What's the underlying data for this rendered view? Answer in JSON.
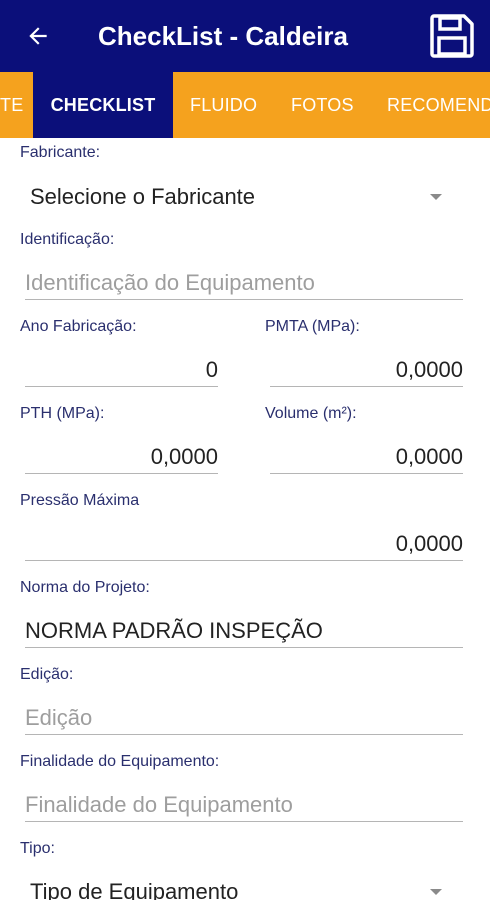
{
  "app_bar": {
    "title": "CheckList - Caldeira",
    "back_icon": "arrow-left-icon",
    "save_icon": "floppy-disk-icon",
    "background": "#0b0f7a"
  },
  "tabs": {
    "background": "#f5a21e",
    "items": [
      {
        "label": "TE",
        "active": false
      },
      {
        "label": "CHECKLIST",
        "active": true
      },
      {
        "label": "FLUIDO",
        "active": false
      },
      {
        "label": "FOTOS",
        "active": false
      },
      {
        "label": "RECOMEND",
        "active": false
      }
    ]
  },
  "form": {
    "fabricante": {
      "label": "Fabricante:",
      "value": "Selecione o Fabricante"
    },
    "identificacao": {
      "label": "Identificação:",
      "placeholder": "Identificação do Equipamento"
    },
    "ano_fabricacao": {
      "label": "Ano Fabricação:",
      "value": "0"
    },
    "pmta": {
      "label": "PMTA (MPa):",
      "value": "0,0000"
    },
    "pth": {
      "label": "PTH (MPa):",
      "value": "0,0000"
    },
    "volume": {
      "label": "Volume (m²):",
      "value": "0,0000"
    },
    "pressao_maxima": {
      "label": "Pressão Máxima",
      "value": "0,0000"
    },
    "norma_projeto": {
      "label": "Norma do Projeto:",
      "value": "NORMA PADRÃO INSPEÇÃO"
    },
    "edicao": {
      "label": "Edição:",
      "placeholder": "Edição"
    },
    "finalidade": {
      "label": "Finalidade do Equipamento:",
      "placeholder": "Finalidade do Equipamento"
    },
    "tipo": {
      "label": "Tipo:",
      "value": "Tipo de Equipamento"
    }
  }
}
